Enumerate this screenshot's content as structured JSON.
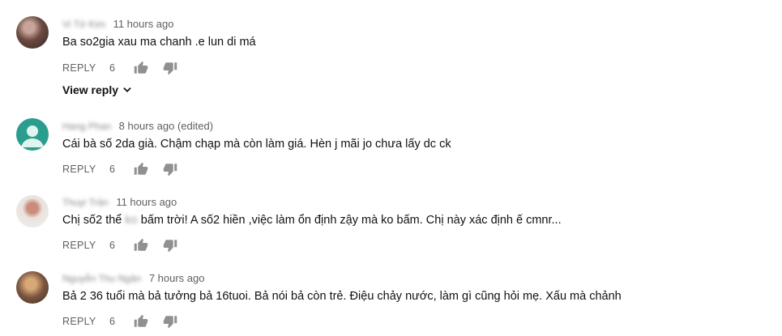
{
  "comments": [
    {
      "author": "Vi Tử Kim",
      "time": "11 hours ago",
      "text": "Ba so2gia xau ma chanh .e lun di má",
      "reply_label": "REPLY",
      "likes": "6",
      "view_reply": "View reply",
      "avatar_color": "#5a3b33"
    },
    {
      "author": "Hang Phan",
      "time": "8 hours ago (edited)",
      "text": "Cái bà số 2da già. Chậm chạp mà còn làm giá. Hèn j mãi jo chưa lấy dc ck",
      "reply_label": "REPLY",
      "likes": "6",
      "avatar_color": "#2a9d8f"
    },
    {
      "author": "Thuyi Trần",
      "time": "11 hours ago",
      "text_before": "Chị số2 thể",
      "text_blurred": "ko",
      "text_after": "bấm trời! A số2 hiền ,việc làm ổn định zậy mà ko bấm. Chị này xác định ế cmnr...",
      "reply_label": "REPLY",
      "likes": "6",
      "avatar_color": "#e9e3df"
    },
    {
      "author": "Nguyễn Thu Ngân",
      "time": "7 hours ago",
      "text": "Bả 2 36 tuổi mà bả tưởng bả 16tuoi. Bả nói bả còn trẻ. Điệu chảy nước, làm gì cũng hỏi mẹ. Xấu mà chảnh",
      "reply_label": "REPLY",
      "likes": "6",
      "avatar_color": "#6b4a3a"
    }
  ],
  "colors": {
    "text_primary": "#111111",
    "text_secondary": "#606060",
    "icon": "#909090"
  }
}
